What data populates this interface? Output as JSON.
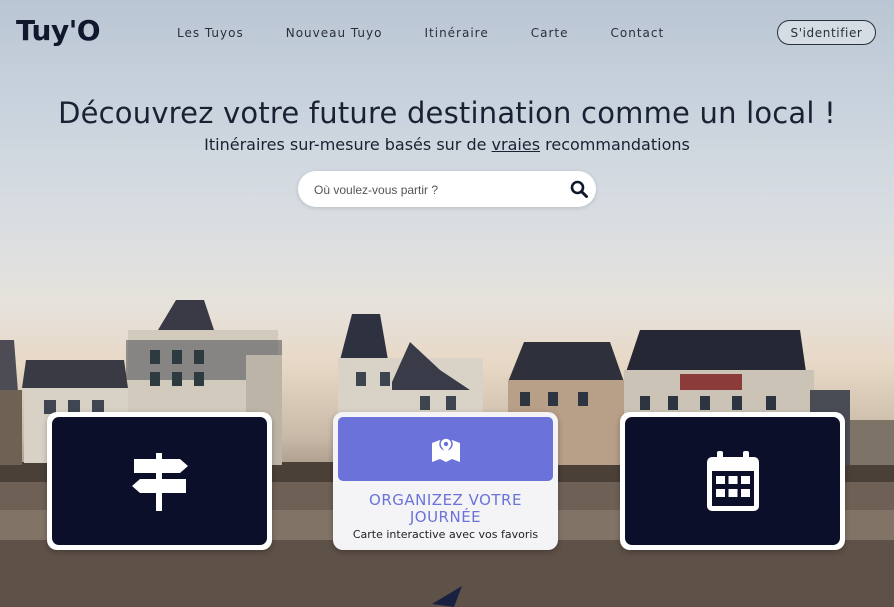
{
  "header": {
    "logo": "Tuy'O",
    "nav": [
      "Les Tuyos",
      "Nouveau Tuyo",
      "Itinéraire",
      "Carte",
      "Contact"
    ],
    "login_label": "S'identifier"
  },
  "hero": {
    "title": "Découvrez votre future destination comme un local !",
    "subtitle_before": "Itinéraires sur-mesure basés sur de ",
    "subtitle_underlined": "vraies",
    "subtitle_after": " recommandations"
  },
  "search": {
    "placeholder": "Où voulez-vous partir ?",
    "icon": "search-icon"
  },
  "cards": [
    {
      "icon": "signpost-icon"
    },
    {
      "icon": "map-marker-icon",
      "title_line1": "ORGANIZEZ VOTRE",
      "title_line2": "JOURNÉE",
      "description": "Carte interactive avec vos favoris"
    },
    {
      "icon": "calendar-icon"
    }
  ],
  "colors": {
    "navy": "#0c0f2a",
    "accent": "#6b72d9",
    "text": "#10182e"
  }
}
